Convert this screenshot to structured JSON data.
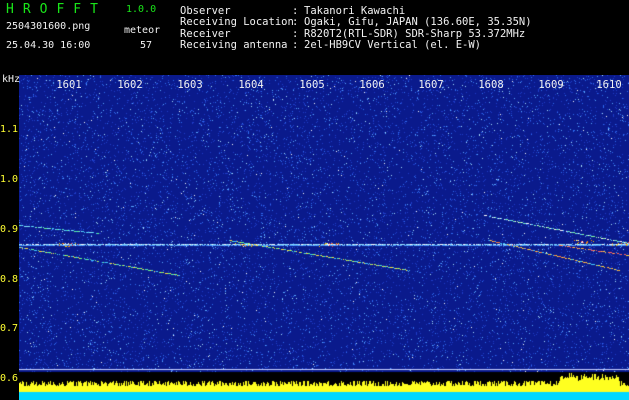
{
  "app": {
    "name": "HROFFT",
    "version": "1.0.0"
  },
  "file_name": "2504301600.png",
  "datetime": "25.04.30 16:00",
  "meteor": {
    "label": "meteor",
    "count": "57"
  },
  "info": [
    {
      "label": "Observer",
      "value": "Takanori Kawachi"
    },
    {
      "label": "Receiving Location",
      "value": "Ogaki, Gifu, JAPAN (136.60E, 35.35N)"
    },
    {
      "label": "Receiver",
      "value": "R820T2(RTL-SDR) SDR-Sharp 53.372MHz"
    },
    {
      "label": "Receiving antenna",
      "value": "2el-HB9CV Vertical (el. E-W)"
    }
  ],
  "separator": ":",
  "y_unit": "kHz",
  "y_ticks": [
    "1.1",
    "1.0",
    "0.9",
    "0.8",
    "0.7",
    "0.6"
  ],
  "x_ticks": [
    "1601",
    "1602",
    "1603",
    "1604",
    "1605",
    "1606",
    "1607",
    "1608",
    "1609",
    "1610"
  ],
  "colors": {
    "background": "#0a1a8c",
    "label_green": "#19e619",
    "tick_yellow": "#ffff33",
    "baseline_cyan": "#00d8ff"
  }
}
